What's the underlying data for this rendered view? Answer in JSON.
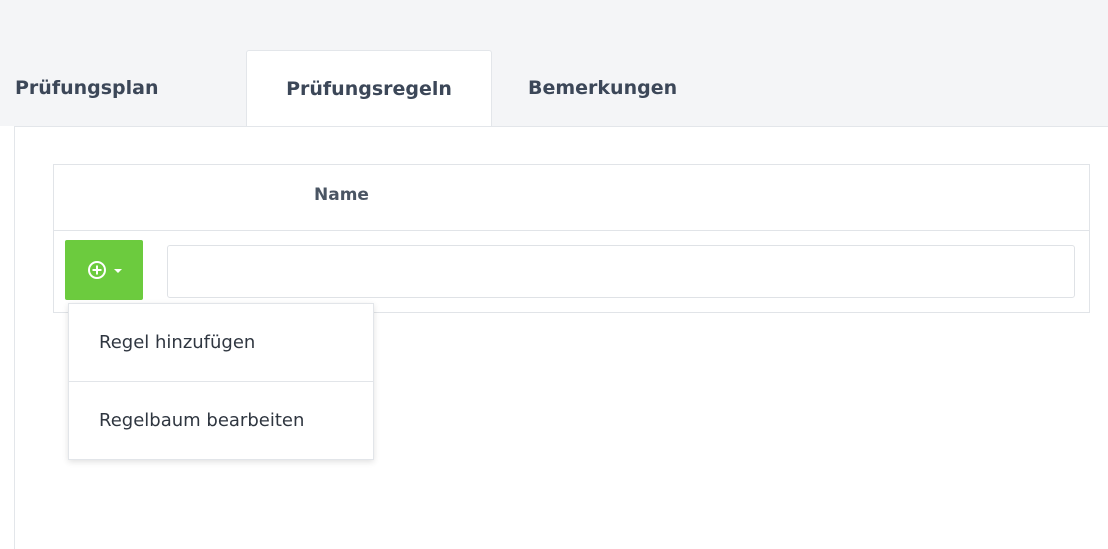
{
  "tabs": [
    {
      "label": "Prüfungsplan",
      "active": false
    },
    {
      "label": "Prüfungsregeln",
      "active": true
    },
    {
      "label": "Bemerkungen",
      "active": false
    }
  ],
  "table": {
    "columns": [
      "",
      "Name"
    ],
    "row": {
      "add_button_icon": "plus-circle-icon",
      "add_button_caret": "caret-down-icon",
      "name_value": ""
    }
  },
  "dropdown": {
    "items": [
      "Regel hinzufügen",
      "Regelbaum bearbeiten"
    ]
  },
  "colors": {
    "accent_green": "#6ccb3e",
    "tab_text": "#3c4758",
    "background_band": "#f4f5f7"
  }
}
